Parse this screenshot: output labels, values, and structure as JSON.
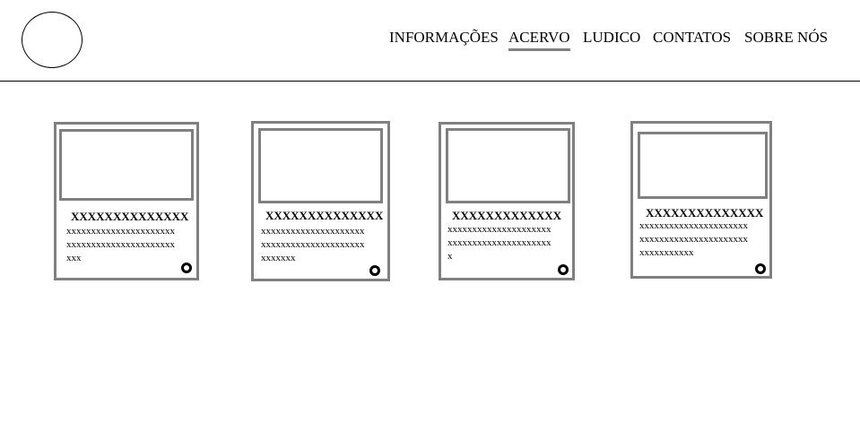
{
  "nav": {
    "items": [
      {
        "label": "INFORMAÇÕES",
        "active": false
      },
      {
        "label": "ACERVO",
        "active": true
      },
      {
        "label": "LUDICO",
        "active": false
      },
      {
        "label": "CONTATOS",
        "active": false
      },
      {
        "label": "SOBRE NÓS",
        "active": false
      }
    ]
  },
  "cards": [
    {
      "title": "XXXXXXXXXXXXXX",
      "lines": [
        "xxxxxxxxxxxxxxxxxxxxxx",
        "xxxxxxxxxxxxxxxxxxxxxx",
        "xxx"
      ]
    },
    {
      "title": "XXXXXXXXXXXXXX",
      "lines": [
        "xxxxxxxxxxxxxxxxxxxxx",
        "xxxxxxxxxxxxxxxxxxxxx",
        "xxxxxxx"
      ]
    },
    {
      "title": "XXXXXXXXXXXXX",
      "lines": [
        "xxxxxxxxxxxxxxxxxxxxx",
        "xxxxxxxxxxxxxxxxxxxxx",
        "x"
      ]
    },
    {
      "title": "XXXXXXXXXXXXXX",
      "lines": [
        "xxxxxxxxxxxxxxxxxxxxxx",
        "xxxxxxxxxxxxxxxxxxxxxx",
        "xxxxxxxxxxx"
      ]
    }
  ]
}
